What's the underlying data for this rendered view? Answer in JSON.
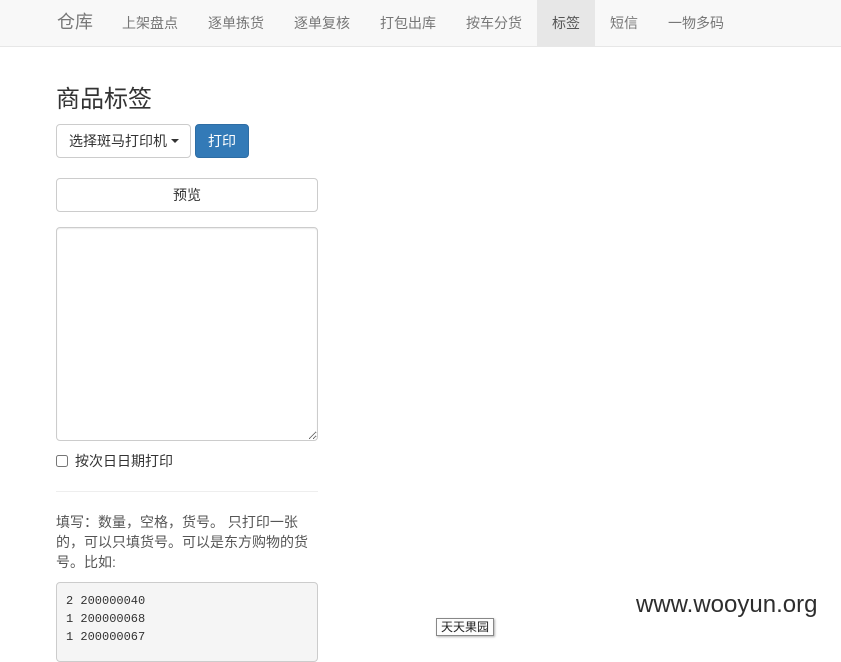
{
  "navbar": {
    "brand": "仓库",
    "items": [
      {
        "label": "上架盘点",
        "active": false
      },
      {
        "label": "逐单拣货",
        "active": false
      },
      {
        "label": "逐单复核",
        "active": false
      },
      {
        "label": "打包出库",
        "active": false
      },
      {
        "label": "按车分货",
        "active": false
      },
      {
        "label": "标签",
        "active": true
      },
      {
        "label": "短信",
        "active": false
      },
      {
        "label": "一物多码",
        "active": false
      }
    ]
  },
  "main": {
    "title": "商品标签",
    "printer_dropdown_label": "选择斑马打印机",
    "print_button_label": "打印",
    "preview_button_label": "预览",
    "input_value": "",
    "next_day_checkbox_label": "按次日日期打印",
    "next_day_checked": false,
    "help_text": "填写：数量，空格，货号。 只打印一张的，可以只填货号。可以是东方购物的货号。比如:",
    "example_lines": [
      "2 200000040",
      "1 200000068",
      "1 200000067"
    ]
  },
  "overlay": {
    "tooltip_text": "天天果园",
    "watermark": "www.wooyun.org"
  }
}
